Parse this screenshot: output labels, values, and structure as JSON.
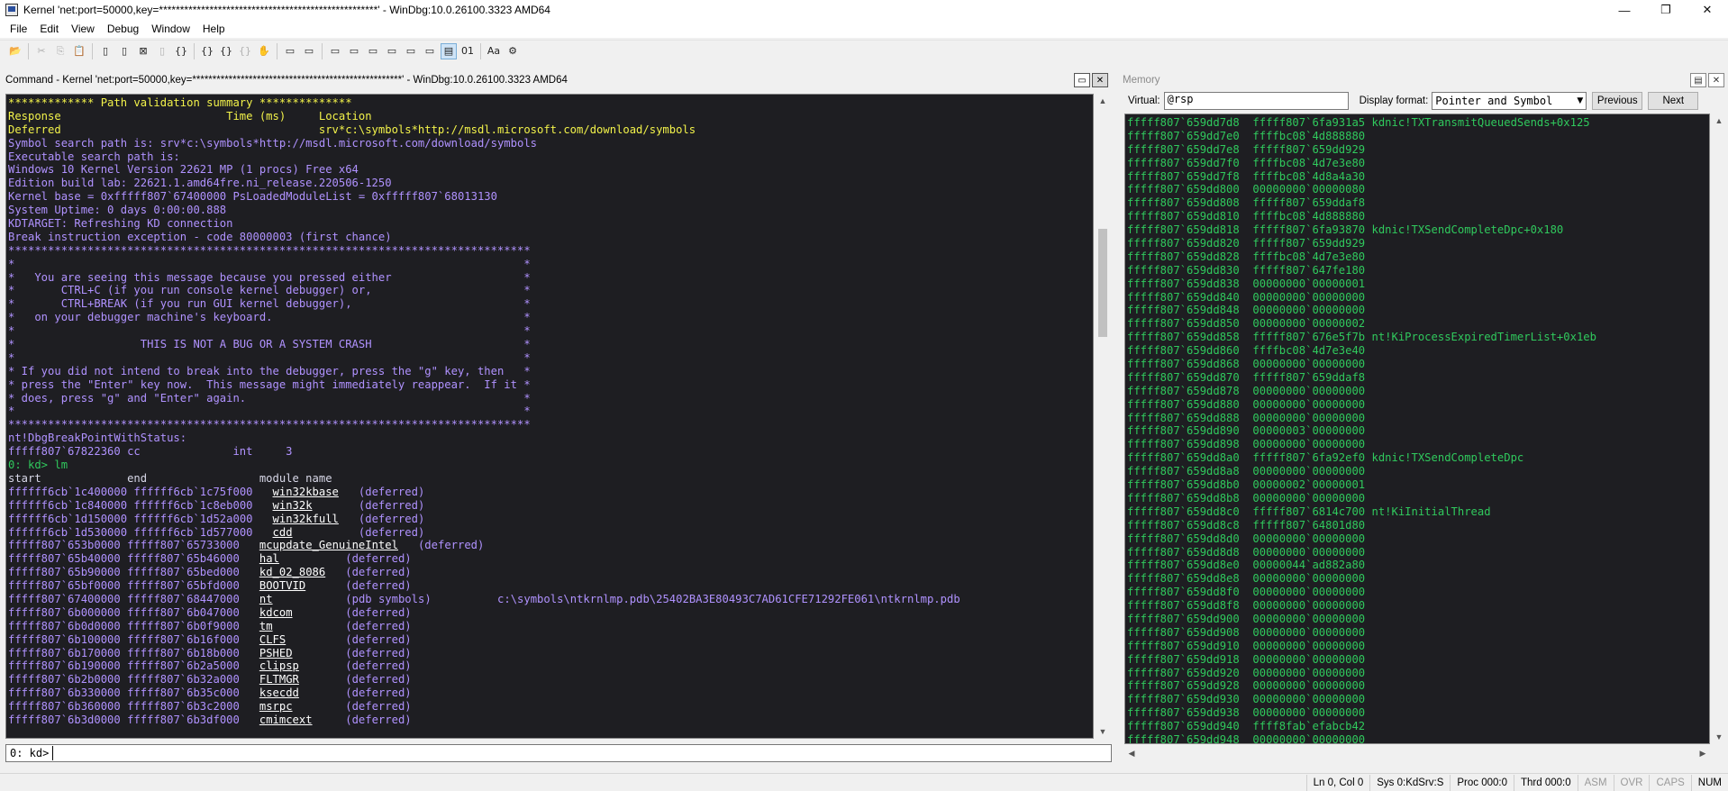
{
  "window": {
    "title": "Kernel 'net:port=50000,key=****************************************************' - WinDbg:10.0.26100.3323 AMD64",
    "minimize": "—",
    "maximize": "❐",
    "close": "✕"
  },
  "menu": [
    "File",
    "Edit",
    "View",
    "Debug",
    "Window",
    "Help"
  ],
  "toolbar": {
    "tools": [
      "open-icon",
      "cut-icon",
      "copy-icon",
      "paste-icon",
      "go-icon",
      "restart-icon",
      "stop-debugging-icon",
      "break-icon",
      "step-into-icon",
      "step-over-icon",
      "step-out-icon",
      "run-to-cursor-icon",
      "hand-icon",
      "command-window-icon",
      "watch-window-icon",
      "locals-window-icon",
      "registers-window-icon",
      "memory-window-icon",
      "call-stack-icon",
      "disassembly-icon",
      "scratch-pad-icon",
      "source-mode-icon",
      "hex-mode-icon",
      "font-icon",
      "options-icon"
    ],
    "glyphs": [
      "📂",
      "✂",
      "⎘",
      "📋",
      "▯",
      "▯",
      "⊠",
      "▯",
      "{}",
      "{}",
      "{}",
      "{}",
      "✋",
      "▭",
      "▭",
      "▭",
      "▭",
      "▭",
      "▭",
      "▭",
      "▭",
      "▤",
      "01",
      "Aa",
      "⚙"
    ]
  },
  "command": {
    "caption": "Command - Kernel 'net:port=50000,key=****************************************************' - WinDbg:10.0.26100.3323 AMD64",
    "prompt": "0: kd>",
    "input_value": "",
    "lines": [
      {
        "c": "y",
        "t": "************* Path validation summary **************"
      },
      {
        "c": "y",
        "t": "Response                         Time (ms)     Location"
      },
      {
        "c": "y",
        "t": "Deferred                                       srv*c:\\symbols*http://msdl.microsoft.com/download/symbols"
      },
      {
        "c": "p",
        "t": "Symbol search path is: srv*c:\\symbols*http://msdl.microsoft.com/download/symbols"
      },
      {
        "c": "p",
        "t": "Executable search path is:"
      },
      {
        "c": "p",
        "t": "Windows 10 Kernel Version 22621 MP (1 procs) Free x64"
      },
      {
        "c": "p",
        "t": "Edition build lab: 22621.1.amd64fre.ni_release.220506-1250"
      },
      {
        "c": "p",
        "t": "Kernel base = 0xfffff807`67400000 PsLoadedModuleList = 0xfffff807`68013130"
      },
      {
        "c": "p",
        "t": "System Uptime: 0 days 0:00:00.888"
      },
      {
        "c": "p",
        "t": "KDTARGET: Refreshing KD connection"
      },
      {
        "c": "p",
        "t": "Break instruction exception - code 80000003 (first chance)"
      },
      {
        "c": "p",
        "t": "*******************************************************************************"
      },
      {
        "c": "p",
        "t": "*                                                                             *"
      },
      {
        "c": "p",
        "t": "*   You are seeing this message because you pressed either                    *"
      },
      {
        "c": "p",
        "t": "*       CTRL+C (if you run console kernel debugger) or,                       *"
      },
      {
        "c": "p",
        "t": "*       CTRL+BREAK (if you run GUI kernel debugger),                          *"
      },
      {
        "c": "p",
        "t": "*   on your debugger machine's keyboard.                                      *"
      },
      {
        "c": "p",
        "t": "*                                                                             *"
      },
      {
        "c": "p",
        "t": "*                   THIS IS NOT A BUG OR A SYSTEM CRASH                       *"
      },
      {
        "c": "p",
        "t": "*                                                                             *"
      },
      {
        "c": "p",
        "t": "* If you did not intend to break into the debugger, press the \"g\" key, then   *"
      },
      {
        "c": "p",
        "t": "* press the \"Enter\" key now.  This message might immediately reappear.  If it *"
      },
      {
        "c": "p",
        "t": "* does, press \"g\" and \"Enter\" again.                                          *"
      },
      {
        "c": "p",
        "t": "*                                                                             *"
      },
      {
        "c": "p",
        "t": "*******************************************************************************"
      },
      {
        "c": "p",
        "t": "nt!DbgBreakPointWithStatus:"
      },
      {
        "c": "p",
        "t": "fffff807`67822360 cc              int     3"
      },
      {
        "c": "g",
        "t": "0: kd> lm"
      },
      {
        "c": "w",
        "t": "start             end                 module name"
      }
    ],
    "modules": [
      {
        "start": "ffffff6cb`1c400000",
        "end": "ffffff6cb`1c75f000",
        "name": "win32kbase",
        "pad": "   ",
        "status": "(deferred)",
        "path": ""
      },
      {
        "start": "ffffff6cb`1c840000",
        "end": "ffffff6cb`1c8eb000",
        "name": "win32k",
        "pad": "       ",
        "status": "(deferred)",
        "path": ""
      },
      {
        "start": "ffffff6cb`1d150000",
        "end": "ffffff6cb`1d52a000",
        "name": "win32kfull",
        "pad": "   ",
        "status": "(deferred)",
        "path": ""
      },
      {
        "start": "ffffff6cb`1d530000",
        "end": "ffffff6cb`1d577000",
        "name": "cdd",
        "pad": "          ",
        "status": "(deferred)",
        "path": ""
      },
      {
        "start": "fffff807`653b0000",
        "end": "fffff807`65733000",
        "name": "mcupdate_GenuineIntel",
        "pad": "   ",
        "status": "(deferred)",
        "path": ""
      },
      {
        "start": "fffff807`65b40000",
        "end": "fffff807`65b46000",
        "name": "hal",
        "pad": "          ",
        "status": "(deferred)",
        "path": ""
      },
      {
        "start": "fffff807`65b90000",
        "end": "fffff807`65bed000",
        "name": "kd_02_8086",
        "pad": "   ",
        "status": "(deferred)",
        "path": ""
      },
      {
        "start": "fffff807`65bf0000",
        "end": "fffff807`65bfd000",
        "name": "BOOTVID",
        "pad": "      ",
        "status": "(deferred)",
        "path": ""
      },
      {
        "start": "fffff807`67400000",
        "end": "fffff807`68447000",
        "name": "nt",
        "pad": "           ",
        "status": "(pdb symbols)",
        "path": "          c:\\symbols\\ntkrnlmp.pdb\\25402BA3E80493C7AD61CFE71292FE061\\ntkrnlmp.pdb"
      },
      {
        "start": "fffff807`6b000000",
        "end": "fffff807`6b047000",
        "name": "kdcom",
        "pad": "        ",
        "status": "(deferred)",
        "path": ""
      },
      {
        "start": "fffff807`6b0d0000",
        "end": "fffff807`6b0f9000",
        "name": "tm",
        "pad": "           ",
        "status": "(deferred)",
        "path": ""
      },
      {
        "start": "fffff807`6b100000",
        "end": "fffff807`6b16f000",
        "name": "CLFS",
        "pad": "         ",
        "status": "(deferred)",
        "path": ""
      },
      {
        "start": "fffff807`6b170000",
        "end": "fffff807`6b18b000",
        "name": "PSHED",
        "pad": "        ",
        "status": "(deferred)",
        "path": ""
      },
      {
        "start": "fffff807`6b190000",
        "end": "fffff807`6b2a5000",
        "name": "clipsp",
        "pad": "       ",
        "status": "(deferred)",
        "path": ""
      },
      {
        "start": "fffff807`6b2b0000",
        "end": "fffff807`6b32a000",
        "name": "FLTMGR",
        "pad": "       ",
        "status": "(deferred)",
        "path": ""
      },
      {
        "start": "fffff807`6b330000",
        "end": "fffff807`6b35c000",
        "name": "ksecdd",
        "pad": "       ",
        "status": "(deferred)",
        "path": ""
      },
      {
        "start": "fffff807`6b360000",
        "end": "fffff807`6b3c2000",
        "name": "msrpc",
        "pad": "        ",
        "status": "(deferred)",
        "path": ""
      },
      {
        "start": "fffff807`6b3d0000",
        "end": "fffff807`6b3df000",
        "name": "cmimcext",
        "pad": "     ",
        "status": "(deferred)",
        "path": ""
      }
    ]
  },
  "memory": {
    "caption": "Memory",
    "virtual_label": "Virtual:",
    "virtual_value": "@rsp",
    "format_label": "Display format:",
    "format_value": "Pointer and Symbol",
    "previous_label": "Previous",
    "next_label": "Next",
    "rows": [
      "fffff807`659dd7d8  fffff807`6fa931a5 kdnic!TXTransmitQueuedSends+0x125",
      "fffff807`659dd7e0  ffffbc08`4d888880",
      "fffff807`659dd7e8  fffff807`659dd929",
      "fffff807`659dd7f0  ffffbc08`4d7e3e80",
      "fffff807`659dd7f8  ffffbc08`4d8a4a30",
      "fffff807`659dd800  00000000`00000080",
      "fffff807`659dd808  fffff807`659ddaf8",
      "fffff807`659dd810  ffffbc08`4d888880",
      "fffff807`659dd818  fffff807`6fa93870 kdnic!TXSendCompleteDpc+0x180",
      "fffff807`659dd820  fffff807`659dd929",
      "fffff807`659dd828  ffffbc08`4d7e3e80",
      "fffff807`659dd830  fffff807`647fe180",
      "fffff807`659dd838  00000000`00000001",
      "fffff807`659dd840  00000000`00000000",
      "fffff807`659dd848  00000000`00000000",
      "fffff807`659dd850  00000000`00000002",
      "fffff807`659dd858  fffff807`676e5f7b nt!KiProcessExpiredTimerList+0x1eb",
      "fffff807`659dd860  ffffbc08`4d7e3e40",
      "fffff807`659dd868  00000000`00000000",
      "fffff807`659dd870  fffff807`659ddaf8",
      "fffff807`659dd878  00000000`00000000",
      "fffff807`659dd880  00000000`00000000",
      "fffff807`659dd888  00000000`00000000",
      "fffff807`659dd890  00000003`00000000",
      "fffff807`659dd898  00000000`00000000",
      "fffff807`659dd8a0  fffff807`6fa92ef0 kdnic!TXSendCompleteDpc",
      "fffff807`659dd8a8  00000000`00000000",
      "fffff807`659dd8b0  00000002`00000001",
      "fffff807`659dd8b8  00000000`00000000",
      "fffff807`659dd8c0  fffff807`6814c700 nt!KiInitialThread",
      "fffff807`659dd8c8  fffff807`64801d80",
      "fffff807`659dd8d0  00000000`00000000",
      "fffff807`659dd8d8  00000000`00000000",
      "fffff807`659dd8e0  00000044`ad882a80",
      "fffff807`659dd8e8  00000000`00000000",
      "fffff807`659dd8f0  00000000`00000000",
      "fffff807`659dd8f8  00000000`00000000",
      "fffff807`659dd900  00000000`00000000",
      "fffff807`659dd908  00000000`00000000",
      "fffff807`659dd910  00000000`00000000",
      "fffff807`659dd918  00000000`00000000",
      "fffff807`659dd920  00000000`00000000",
      "fffff807`659dd928  00000000`00000000",
      "fffff807`659dd930  00000000`00000000",
      "fffff807`659dd938  00000000`00000000",
      "fffff807`659dd940  ffff8fab`efabcb42",
      "fffff807`659dd948  00000000`00000000"
    ]
  },
  "status": {
    "position": "Ln 0, Col 0",
    "sys": "Sys 0:KdSrv:S",
    "proc": "Proc 000:0",
    "thrd": "Thrd 000:0",
    "asm": "ASM",
    "ovr": "OVR",
    "caps": "CAPS",
    "num": "NUM"
  },
  "colors": {
    "console_bg": "#1e1e22",
    "yellow_text": "#f2f24a",
    "purple_text": "#b092ff",
    "green_text": "#30c95d"
  }
}
